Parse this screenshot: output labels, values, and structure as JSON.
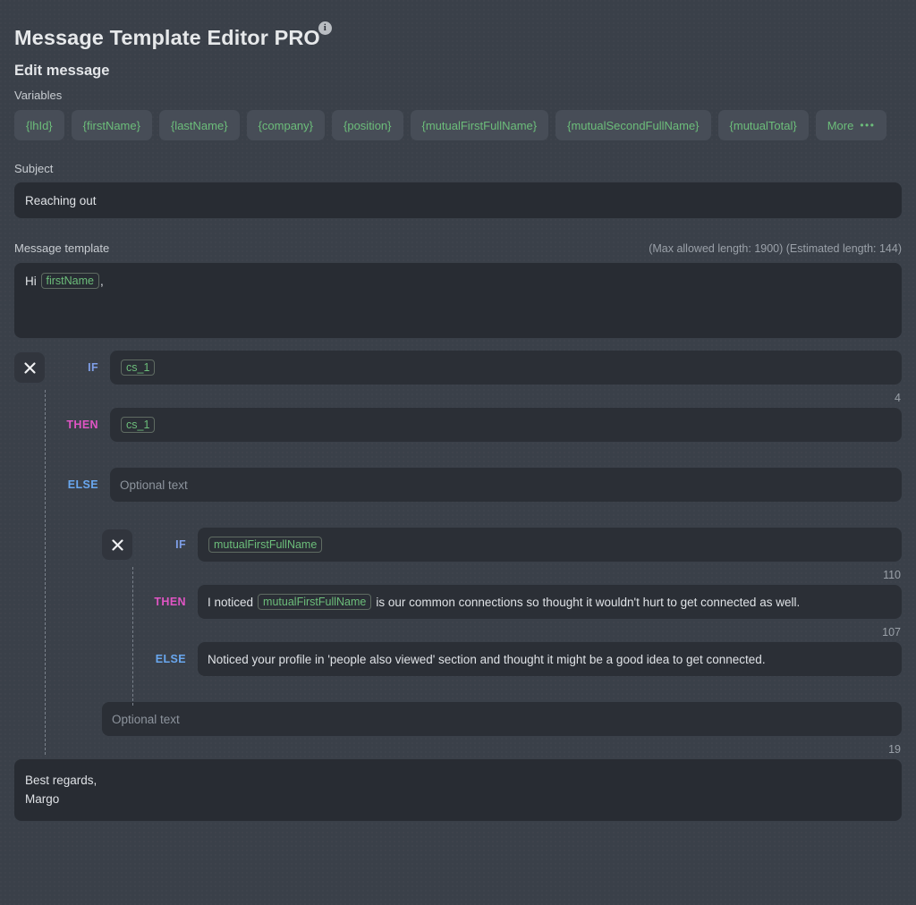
{
  "header": {
    "title": "Message Template Editor PRO",
    "info_icon": "info-icon",
    "info_glyph": "i"
  },
  "edit_section": {
    "heading": "Edit message",
    "variables_label": "Variables",
    "variables": [
      {
        "label": "{lhId}"
      },
      {
        "label": "{firstName}"
      },
      {
        "label": "{lastName}"
      },
      {
        "label": "{company}"
      },
      {
        "label": "{position}"
      },
      {
        "label": "{mutualFirstFullName}"
      },
      {
        "label": "{mutualSecondFullName}"
      },
      {
        "label": "{mutualTotal}"
      }
    ],
    "more_label": "More",
    "more_dots": "•••"
  },
  "subject": {
    "label": "Subject",
    "value": "Reaching out",
    "placeholder": "Subject"
  },
  "message_template": {
    "label": "Message template",
    "meta": "(Max allowed length: 1900) (Estimated length: 144)",
    "max_allowed_length": 1900,
    "estimated_length": 144,
    "greeting_prefix": "Hi",
    "greeting_token": "firstName",
    "greeting_suffix": ","
  },
  "conditions": {
    "outer": {
      "close_label": "×",
      "if_label": "IF",
      "then_label": "THEN",
      "else_label": "ELSE",
      "if_token": "cs_1",
      "then_token": "cs_1",
      "else_placeholder": "Optional text",
      "if_counter": "4"
    },
    "inner": {
      "close_label": "×",
      "if_label": "IF",
      "then_label": "THEN",
      "else_label": "ELSE",
      "if_token": "mutualFirstFullName",
      "then_prefix": "I noticed",
      "then_token": "mutualFirstFullName",
      "then_suffix": "is our common connections so thought it wouldn't hurt to get connected as well.",
      "else_text": "Noticed your profile in 'people also viewed' section and thought it might be a good idea to get connected.",
      "if_counter": "110",
      "then_counter": "107"
    },
    "tail": {
      "placeholder": "Optional text",
      "counter": "19"
    }
  },
  "signature": {
    "line1": "Best regards,",
    "line2": "Margo"
  },
  "colors": {
    "page_background": "#3a4049",
    "input_background": "#282c33",
    "cond_input_background": "#2b2f36",
    "chip_background": "#474d57",
    "variable_green": "#6cbd7a",
    "keyword_if": "#7f9fe8",
    "keyword_then": "#e055c4",
    "keyword_else": "#69a7ef",
    "text_primary": "#dfe2e6",
    "text_muted": "#9aa0a8"
  }
}
